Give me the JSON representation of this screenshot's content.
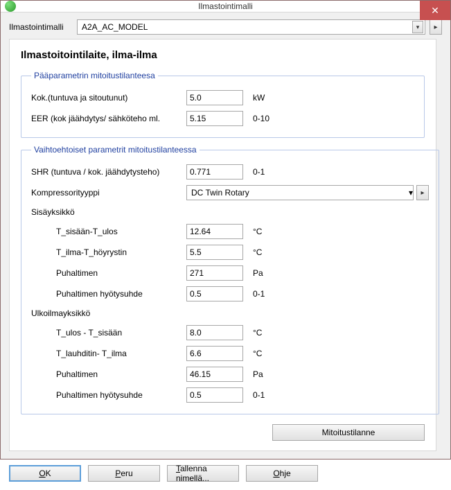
{
  "window": {
    "title": "Ilmastointimalli"
  },
  "model": {
    "label": "Ilmastointimalli",
    "value": "A2A_AC_MODEL"
  },
  "panelTitle": "Ilmastoitointilaite, ilma-ilma",
  "group1": {
    "legend": "Pääparametrin mitoitustilanteesa",
    "rows": {
      "kok": {
        "label": "Kok.(tuntuva ja sitoutunut)",
        "value": "5.0",
        "unit": "kW"
      },
      "eer": {
        "label": "EER (kok jäähdytys/ sähköteho ml.",
        "value": "5.15",
        "unit": "0-10"
      }
    }
  },
  "group2": {
    "legend": "Vaihtoehtoiset parametrit mitoitustilanteessa",
    "shr": {
      "label": "SHR (tuntuva / kok. jäähdytysteho)",
      "value": "0.771",
      "unit": "0-1"
    },
    "comp": {
      "label": "Kompressorityyppi",
      "value": "DC Twin Rotary"
    },
    "indoor": {
      "title": "Sisäyksikkö",
      "tSisUlos": {
        "label": "T_sisään-T_ulos",
        "value": "12.64",
        "unit": "°C"
      },
      "tIlmaHoy": {
        "label": "T_ilma-T_höyrystin",
        "value": "5.5",
        "unit": "°C"
      },
      "puhaltimen": {
        "label": "Puhaltimen",
        "value": "271",
        "unit": "Pa"
      },
      "puhHyoty": {
        "label": "Puhaltimen hyötysuhde",
        "value": "0.5",
        "unit": "0-1"
      }
    },
    "outdoor": {
      "title": "Ulkoilmayksikkö",
      "tUlosSis": {
        "label": "T_ulos - T_sisään",
        "value": "8.0",
        "unit": "°C"
      },
      "tLauhIlma": {
        "label": "T_lauhditin- T_ilma",
        "value": "6.6",
        "unit": "°C"
      },
      "puhaltimen": {
        "label": "Puhaltimen",
        "value": "46.15",
        "unit": "Pa"
      },
      "puhHyoty": {
        "label": "Puhaltimen hyötysuhde",
        "value": "0.5",
        "unit": "0-1"
      }
    }
  },
  "buttons": {
    "sizing": "Mitoitustilanne",
    "ok": "OK",
    "cancel": "Peru",
    "saveAs": "Tallenna nimellä...",
    "help": "Ohje"
  }
}
